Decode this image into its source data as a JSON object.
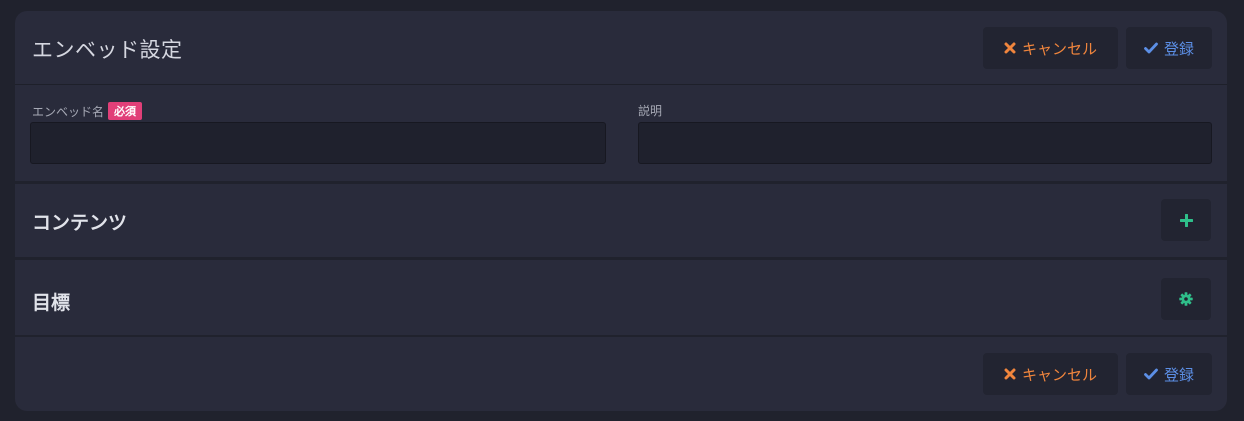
{
  "header": {
    "title": "エンベッド設定",
    "cancel_label": "キャンセル",
    "save_label": "登録"
  },
  "form": {
    "name_label": "エンベッド名",
    "required_badge": "必須",
    "name_value": "",
    "description_label": "説明",
    "description_value": ""
  },
  "sections": {
    "contents_title": "コンテンツ",
    "goal_title": "目標"
  },
  "footer": {
    "cancel_label": "キャンセル",
    "save_label": "登録"
  },
  "icons": {
    "cancel": "close-icon",
    "save": "check-icon",
    "add": "plus-icon",
    "settings": "gear-icon"
  },
  "colors": {
    "cancel": "#f0853d",
    "save": "#5c8fe6",
    "accent_green": "#2fbf8a",
    "required_badge": "#e13f78"
  }
}
